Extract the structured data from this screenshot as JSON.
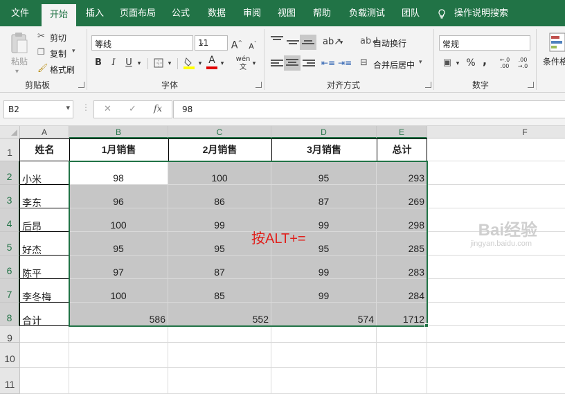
{
  "ribbon_tabs": [
    "文件",
    "开始",
    "插入",
    "页面布局",
    "公式",
    "数据",
    "审阅",
    "视图",
    "帮助",
    "负载测试",
    "团队",
    "操作说明搜索"
  ],
  "active_tab": "开始",
  "clipboard": {
    "paste": "粘贴",
    "cut": "剪切",
    "copy": "复制",
    "format_painter": "格式刷",
    "group": "剪贴板"
  },
  "font": {
    "name": "等线",
    "size": "11",
    "grow": "A",
    "shrink": "A",
    "bold": "B",
    "italic": "I",
    "underline": "U",
    "phonetic": "wén",
    "group": "字体"
  },
  "alignment": {
    "wrap_text": "自动换行",
    "merge_center": "合并后居中",
    "group": "对齐方式"
  },
  "number": {
    "format": "常规",
    "percent": "%",
    "comma": ",",
    "inc_decimal": "←.0 .00",
    "dec_decimal": ".00 →.0",
    "group": "数字"
  },
  "styles": {
    "conditional_format": "条件格"
  },
  "formula_bar": {
    "name_box": "B2",
    "cancel": "✕",
    "enter": "✓",
    "fx": "fx",
    "value": "98"
  },
  "columns": [
    "A",
    "B",
    "C",
    "D",
    "E",
    "F"
  ],
  "rows": [
    "1",
    "2",
    "3",
    "4",
    "5",
    "6",
    "7",
    "8",
    "9",
    "10",
    "11"
  ],
  "table": {
    "headers": [
      "姓名",
      "1月销售",
      "2月销售",
      "3月销售",
      "总计"
    ],
    "rows": [
      [
        "小米",
        "98",
        "100",
        "95",
        "293"
      ],
      [
        "李东",
        "96",
        "86",
        "87",
        "269"
      ],
      [
        "后昂",
        "100",
        "99",
        "99",
        "298"
      ],
      [
        "好杰",
        "95",
        "95",
        "95",
        "285"
      ],
      [
        "陈平",
        "97",
        "87",
        "99",
        "283"
      ],
      [
        "李冬梅",
        "100",
        "85",
        "99",
        "284"
      ],
      [
        "合计",
        "586",
        "552",
        "574",
        "1712"
      ]
    ]
  },
  "annotation": "按ALT+=",
  "watermark": {
    "text": "Bai经验",
    "url": "jingyan.baidu.com"
  },
  "colors": {
    "accent": "#217346",
    "selection_fill": "#c6c6c6",
    "annotation": "#e0201c"
  }
}
